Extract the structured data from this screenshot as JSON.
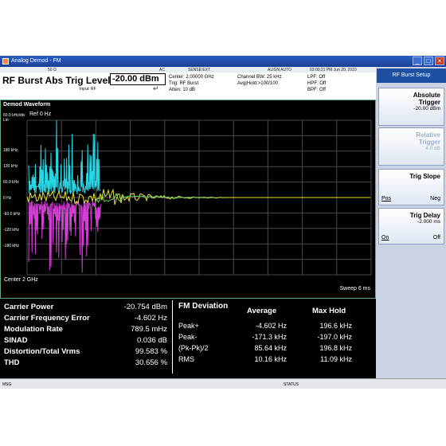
{
  "window": {
    "title": "Analog Demod - FM"
  },
  "status": {
    "field1": "50 Ω",
    "field2": "AC",
    "field3": "SENSE:EXT",
    "field4": "ALIGN AUTO",
    "datetime": "03:00:21 PM Jun 20, 2010"
  },
  "header": {
    "title": "RF Burst Abs Trig Level",
    "trig_value": "-20.00 dBm",
    "input": "Input: RF",
    "center": "Center: 2.00000 GHz",
    "trig": "Trig: RF Burst",
    "atten": "Atten: 10 dB",
    "channel_bw": "Channel BW: 25 kHz",
    "avg_hold": "Avg|Hold:>100/100",
    "lpf": "LPF: Off",
    "hpf": "HPF: Off",
    "bpf": "BPF: Off"
  },
  "plot": {
    "title": "Demod Waveform",
    "scale": "60.0 kHz/div",
    "scale_unit": "Lin",
    "ref": "Ref 0 Hz",
    "y_ticks": [
      "180 kHz",
      "120 kHz",
      "60.0 kHz",
      "0 Hz",
      "-60.0 kHz",
      "-120 kHz",
      "-180 kHz"
    ],
    "center": "Center  2 GHz",
    "sweep": "Sweep  6 ms",
    "colors": {
      "grid": "#4a4a4a",
      "cyan": "#27d7e6",
      "magenta": "#d53fd8",
      "yellow": "#e8e23a",
      "green": "#6cd56c"
    }
  },
  "results": {
    "rows": [
      {
        "label": "Carrier Power",
        "value": "-20.754 dBm"
      },
      {
        "label": "Carrier Frequency Error",
        "value": "-4.602 Hz"
      },
      {
        "label": "Modulation Rate",
        "value": "789.5 mHz"
      },
      {
        "label": "SINAD",
        "value": "0.036 dB"
      },
      {
        "label": "Distortion/Total Vrms",
        "value": "99.583 %"
      },
      {
        "label": "THD",
        "value": "30.656 %"
      }
    ],
    "fm_title": "FM Deviation",
    "col_average": "Average",
    "col_maxhold": "Max Hold",
    "fm_rows": [
      {
        "label": "Peak+",
        "avg": "-4.602 Hz",
        "max": "196.6 kHz"
      },
      {
        "label": "Peak-",
        "avg": "-171.3 kHz",
        "max": "-197.0 kHz"
      },
      {
        "label": "(Pk-Pk)/2",
        "avg": "85.64 kHz",
        "max": "196.8 kHz"
      },
      {
        "label": "RMS",
        "avg": "10.16 kHz",
        "max": "11.09 kHz"
      }
    ]
  },
  "softkeys": {
    "title": "RF Burst Setup",
    "abs_trigger": {
      "label1": "Absolute",
      "label2": "Trigger",
      "value": "-20.00 dBm"
    },
    "rel_trigger": {
      "label1": "Relative",
      "label2": "Trigger",
      "value": "4.0 dB"
    },
    "trig_slope": {
      "label": "Trig Slope",
      "opt1": "Pos",
      "opt2": "Neg"
    },
    "trig_delay": {
      "label": "Trig Delay",
      "value": "-2.000 ms",
      "opt1": "On",
      "opt2": "Off"
    }
  },
  "bottom": {
    "msg": "MSG",
    "status": "STATUS"
  }
}
